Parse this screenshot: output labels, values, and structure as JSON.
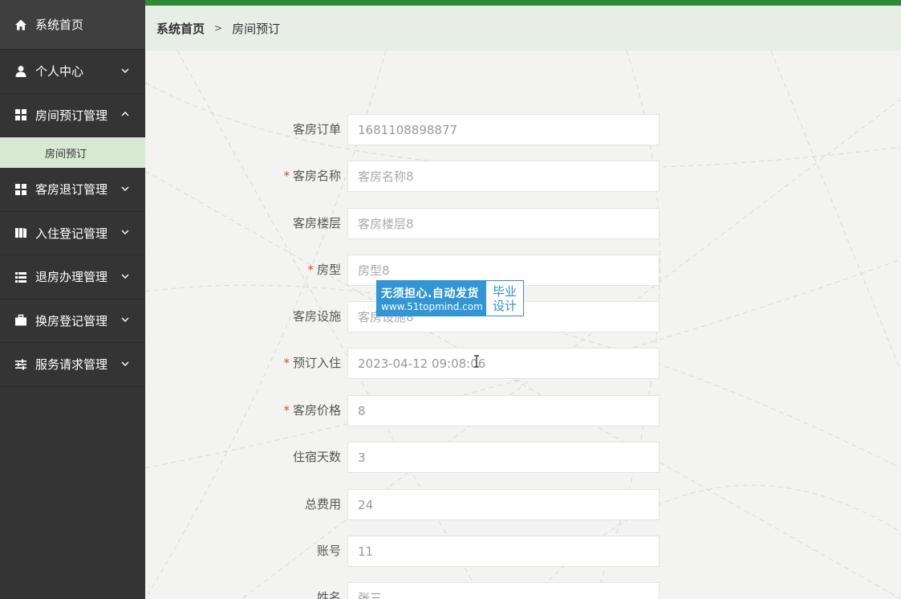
{
  "sidebar": {
    "items": [
      {
        "label": "系统首页",
        "icon": "home-icon"
      },
      {
        "label": "个人中心",
        "icon": "user-icon"
      },
      {
        "label": "房间预订管理",
        "icon": "grid-icon"
      },
      {
        "label": "客房退订管理",
        "icon": "grid-icon"
      },
      {
        "label": "入住登记管理",
        "icon": "columns-icon"
      },
      {
        "label": "退房办理管理",
        "icon": "list-icon"
      },
      {
        "label": "换房登记管理",
        "icon": "briefcase-icon"
      },
      {
        "label": "服务请求管理",
        "icon": "sliders-icon"
      }
    ],
    "sub_item": "房间预订"
  },
  "breadcrumb": {
    "home": "系统首页",
    "separator": ">",
    "current": "房间预订"
  },
  "form": {
    "fields": [
      {
        "label": "客房订单",
        "required": false,
        "value": "1681108898877",
        "placeholder": ""
      },
      {
        "label": "客房名称",
        "required": true,
        "value": "",
        "placeholder": "客房名称8"
      },
      {
        "label": "客房楼层",
        "required": false,
        "value": "",
        "placeholder": "客房楼层8"
      },
      {
        "label": "房型",
        "required": true,
        "value": "",
        "placeholder": "房型8"
      },
      {
        "label": "客房设施",
        "required": false,
        "value": "",
        "placeholder": "客房设施8"
      },
      {
        "label": "预订入住",
        "required": true,
        "value": "2023-04-12 09:08:06",
        "placeholder": ""
      },
      {
        "label": "客房价格",
        "required": true,
        "value": "8",
        "placeholder": ""
      },
      {
        "label": "住宿天数",
        "required": false,
        "value": "3",
        "placeholder": ""
      },
      {
        "label": "总费用",
        "required": false,
        "value": "24",
        "placeholder": ""
      },
      {
        "label": "账号",
        "required": false,
        "value": "11",
        "placeholder": ""
      },
      {
        "label": "姓名",
        "required": false,
        "value": "张三",
        "placeholder": ""
      }
    ],
    "required_mark": "*"
  },
  "watermark": {
    "line1": "无须担心.自动发货",
    "line2": "www.51topmind.com",
    "right1": "毕业",
    "right2": "设计"
  },
  "colors": {
    "sidebar_bg": "#343434",
    "accent_green": "#2d8a37",
    "submenu_bg": "#d7e8d3",
    "required": "#e0463d",
    "watermark_blue": "#3196d6"
  }
}
